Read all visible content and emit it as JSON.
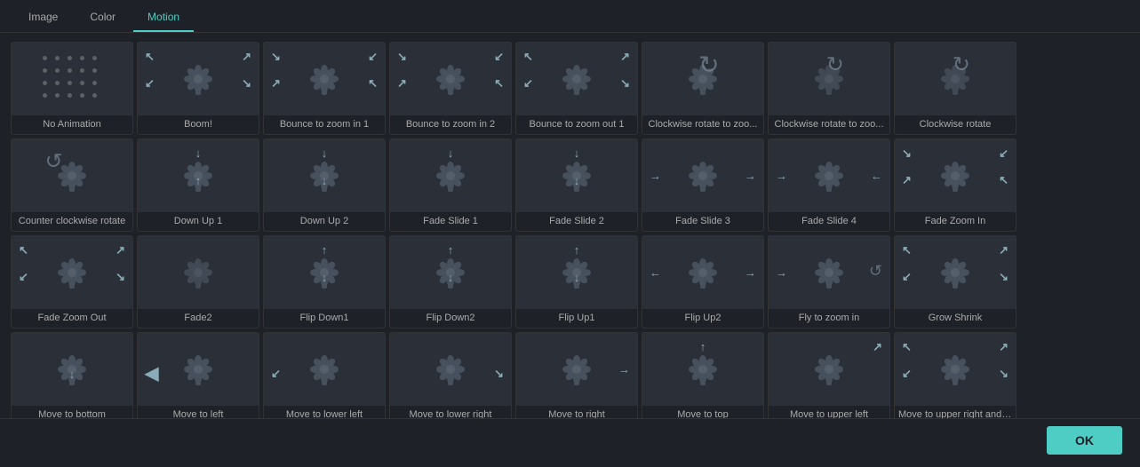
{
  "tabs": [
    {
      "id": "image",
      "label": "Image",
      "active": false
    },
    {
      "id": "color",
      "label": "Color",
      "active": false
    },
    {
      "id": "motion",
      "label": "Motion",
      "active": true
    }
  ],
  "footer": {
    "ok_label": "OK"
  },
  "animations": [
    {
      "id": "no-animation",
      "label": "No Animation",
      "type": "dots"
    },
    {
      "id": "boom",
      "label": "Boom!",
      "type": "flower-corners-out"
    },
    {
      "id": "bounce-zoom-in-1",
      "label": "Bounce to zoom in 1",
      "type": "flower-corners-in"
    },
    {
      "id": "bounce-zoom-in-2",
      "label": "Bounce to zoom in 2",
      "type": "flower-corners-in2"
    },
    {
      "id": "bounce-zoom-out-1",
      "label": "Bounce to zoom out 1",
      "type": "flower-corners-out2"
    },
    {
      "id": "clockwise-rotate-zoo1",
      "label": "Clockwise rotate to zoo...",
      "type": "flower-rotate-cw"
    },
    {
      "id": "clockwise-rotate-zoo2",
      "label": "Clockwise rotate to zoo...",
      "type": "flower-rotate-cw2"
    },
    {
      "id": "clockwise-rotate",
      "label": "Clockwise rotate",
      "type": "flower-rotate-cw3"
    },
    {
      "id": "counter-clockwise",
      "label": "Counter clockwise rotate",
      "type": "flower-rotate-ccw"
    },
    {
      "id": "down-up-1",
      "label": "Down Up 1",
      "type": "flower-down-up"
    },
    {
      "id": "down-up-2",
      "label": "Down Up 2",
      "type": "flower-down-up2"
    },
    {
      "id": "fade-slide-1",
      "label": "Fade Slide 1",
      "type": "flower-fade1"
    },
    {
      "id": "fade-slide-2",
      "label": "Fade Slide 2",
      "type": "flower-fade2"
    },
    {
      "id": "fade-slide-3",
      "label": "Fade Slide 3",
      "type": "flower-fade3"
    },
    {
      "id": "fade-slide-4",
      "label": "Fade Slide 4",
      "type": "flower-fade4"
    },
    {
      "id": "fade-zoom-in",
      "label": "Fade Zoom In",
      "type": "flower-fade-zoom-in"
    },
    {
      "id": "fade-zoom-out",
      "label": "Fade Zoom Out",
      "type": "flower-fade-zoom-out"
    },
    {
      "id": "fade2",
      "label": "Fade2",
      "type": "flower-plain"
    },
    {
      "id": "flip-down1",
      "label": "Flip Down1",
      "type": "flower-flip-down1"
    },
    {
      "id": "flip-down2",
      "label": "Flip Down2",
      "type": "flower-flip-down2"
    },
    {
      "id": "flip-up1",
      "label": "Flip Up1",
      "type": "flower-flip-up1"
    },
    {
      "id": "flip-up2",
      "label": "Flip Up2",
      "type": "flower-flip-up2"
    },
    {
      "id": "fly-to-zoom",
      "label": "Fly to zoom in",
      "type": "flower-fly-zoom"
    },
    {
      "id": "grow-shrink",
      "label": "Grow Shrink",
      "type": "flower-grow-shrink"
    },
    {
      "id": "move-bottom",
      "label": "Move to bottom",
      "type": "flower-move-bottom"
    },
    {
      "id": "move-left",
      "label": "Move to left",
      "type": "flower-move-left"
    },
    {
      "id": "move-lower-left",
      "label": "Move to lower left",
      "type": "flower-move-lower-left"
    },
    {
      "id": "move-lower-right",
      "label": "Move to lower right",
      "type": "flower-move-lower-right"
    },
    {
      "id": "move-right",
      "label": "Move to right",
      "type": "flower-move-right"
    },
    {
      "id": "move-top",
      "label": "Move to top",
      "type": "flower-move-top"
    },
    {
      "id": "move-upper-left",
      "label": "Move to upper left",
      "type": "flower-move-upper-left"
    },
    {
      "id": "move-upper-right",
      "label": "Move to upper right and ...",
      "type": "flower-move-upper-right"
    }
  ]
}
